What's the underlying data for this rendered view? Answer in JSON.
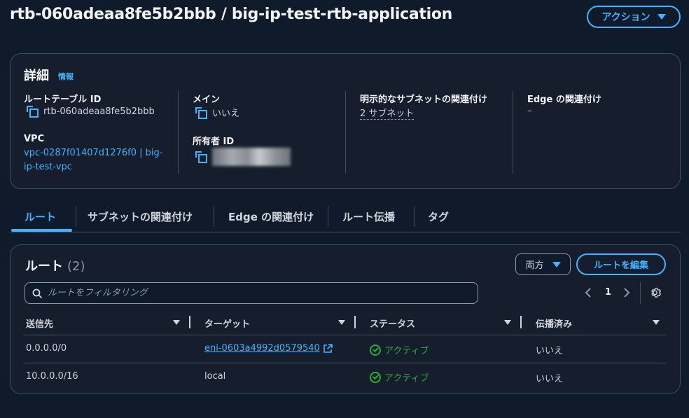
{
  "header": {
    "title": "rtb-060adeaa8fe5b2bbb / big-ip-test-rtb-application",
    "actions_label": "アクション"
  },
  "details": {
    "title": "詳細",
    "info_label": "情報",
    "route_table_id_label": "ルートテーブル ID",
    "route_table_id_value": "rtb-060adeaa8fe5b2bbb",
    "main_label": "メイン",
    "main_value": "いいえ",
    "explicit_subnet_label": "明示的なサブネットの関連付け",
    "explicit_subnet_value": "2 サブネット",
    "edge_label": "Edge の関連付け",
    "edge_value": "–",
    "vpc_label": "VPC",
    "vpc_value_line1": "vpc-0287f01407d1276f0 | big-",
    "vpc_value_line2": "ip-test-vpc",
    "owner_label": "所有者 ID"
  },
  "tabs": [
    {
      "label": "ルート"
    },
    {
      "label": "サブネットの関連付け"
    },
    {
      "label": "Edge の関連付け"
    },
    {
      "label": "ルート伝播"
    },
    {
      "label": "タグ"
    }
  ],
  "routes": {
    "title": "ルート",
    "count": "(2)",
    "filter_select_label": "両方",
    "edit_button_label": "ルートを編集",
    "search_placeholder": "ルートをフィルタリング",
    "page_number": "1",
    "columns": [
      "送信先",
      "ターゲット",
      "ステータス",
      "伝播済み"
    ],
    "rows": [
      {
        "destination": "0.0.0.0/0",
        "target": "eni-0603a4992d0579540",
        "status": "アクティブ",
        "propagated": "いいえ"
      },
      {
        "destination": "10.0.0.0/16",
        "target": "local",
        "status": "アクティブ",
        "propagated": "いいえ"
      }
    ]
  },
  "colors": {
    "background": "#0f1b2a",
    "panel": "#161e2d",
    "accent": "#42b4ff",
    "success": "#29ad32"
  }
}
